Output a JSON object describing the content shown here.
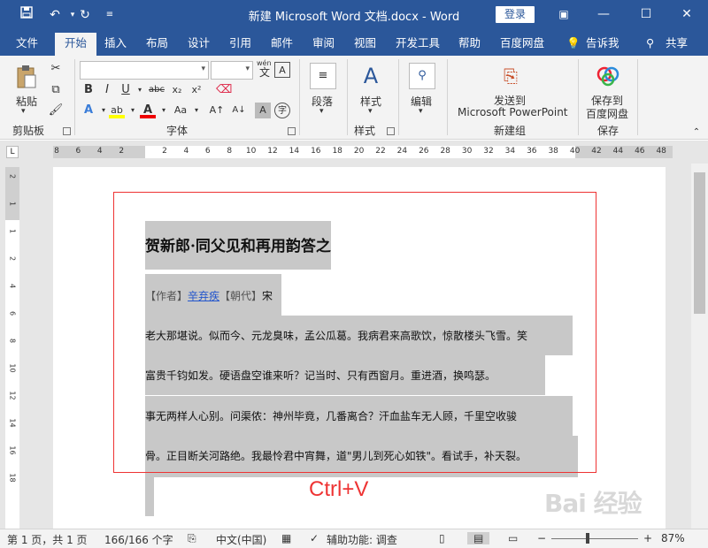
{
  "titlebar": {
    "document_title": "新建 Microsoft Word 文档.docx  -  Word",
    "login_label": "登录",
    "save_icon": "save-icon",
    "undo_icon": "undo-icon",
    "redo_icon": "redo-icon",
    "customize_icon": "customize-quick-access-icon"
  },
  "tabs": [
    "文件",
    "开始",
    "插入",
    "布局",
    "设计",
    "引用",
    "邮件",
    "审阅",
    "视图",
    "开发工具",
    "帮助",
    "百度网盘"
  ],
  "active_tab": "开始",
  "tell_me": "告诉我",
  "share": "共享",
  "ribbon": {
    "clipboard": {
      "paste": "粘贴",
      "label": "剪贴板"
    },
    "font": {
      "label": "字体",
      "font_name": "",
      "font_size": "",
      "wen_label": "wén"
    },
    "paragraph": {
      "label": "段落"
    },
    "styles": {
      "button": "样式",
      "label": "样式"
    },
    "editing": {
      "button": "编辑"
    },
    "new_group": {
      "line1": "发送到",
      "line2": "Microsoft PowerPoint",
      "label": "新建组"
    },
    "save": {
      "line1": "保存到",
      "line2": "百度网盘",
      "label": "保存"
    }
  },
  "ruler": {
    "ticks": [
      "8",
      "6",
      "4",
      "2",
      "",
      "2",
      "4",
      "6",
      "8",
      "10",
      "12",
      "14",
      "16",
      "18",
      "20",
      "22",
      "24",
      "26",
      "28",
      "30",
      "32",
      "34",
      "36",
      "38",
      "40",
      "42",
      "44",
      "46",
      "48"
    ],
    "vticks": [
      "2",
      "1",
      "1",
      "2",
      "4",
      "6",
      "8",
      "10",
      "12",
      "14",
      "16",
      "18"
    ]
  },
  "document": {
    "title": "贺新郎·同父见和再用韵答之",
    "author_prefix": "【作者】",
    "author": "辛弃疾",
    "dynasty_prefix": "【朝代】",
    "dynasty": "宋",
    "lines": [
      "老大那堪说。似而今、元龙臭味，孟公瓜葛。我病君来高歌饮，惊散楼头飞雪。笑",
      "富贵千钧如发。硬语盘空谁来听？记当时、只有西窗月。重进酒，换鸣瑟。",
      "事无两样人心别。问渠侬：神州毕竟，几番离合？汗血盐车无人顾，千里空收骏",
      "骨。正目断关河路绝。我最怜君中宵舞，道\"男儿到死心如铁\"。看试手，补天裂。"
    ],
    "annotation": "Ctrl+V"
  },
  "statusbar": {
    "page": "第 1 页，共 1 页",
    "words": "166/166 个字",
    "language": "中文(中国)",
    "accessibility": "辅助功能: 调查",
    "zoom": "87%"
  },
  "watermark": "Bai 经验",
  "colors": {
    "accent": "#2b579a",
    "annotation_red": "#ee3333",
    "selection": "#c8c8c8"
  }
}
